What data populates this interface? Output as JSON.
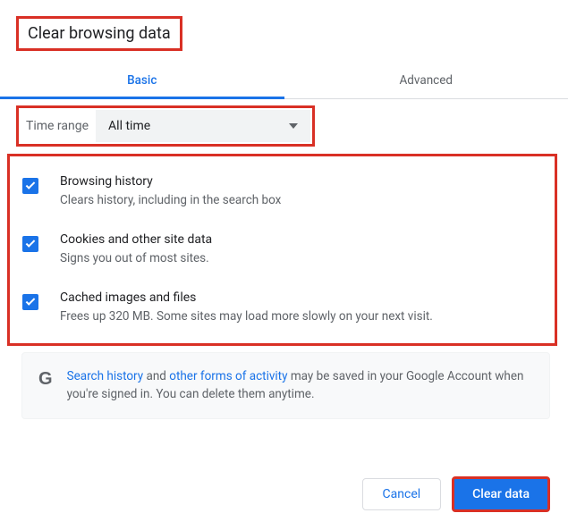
{
  "title": "Clear browsing data",
  "tabs": {
    "basic": "Basic",
    "advanced": "Advanced"
  },
  "timerange": {
    "label": "Time range",
    "value": "All time"
  },
  "options": [
    {
      "title": "Browsing history",
      "desc": "Clears history, including in the search box"
    },
    {
      "title": "Cookies and other site data",
      "desc": "Signs you out of most sites."
    },
    {
      "title": "Cached images and files",
      "desc": "Frees up 320 MB. Some sites may load more slowly on your next visit."
    }
  ],
  "info": {
    "link1": "Search history",
    "mid": " and ",
    "link2": "other forms of activity",
    "rest": " may be saved in your Google Account when you're signed in. You can delete them anytime."
  },
  "buttons": {
    "cancel": "Cancel",
    "clear": "Clear data"
  }
}
